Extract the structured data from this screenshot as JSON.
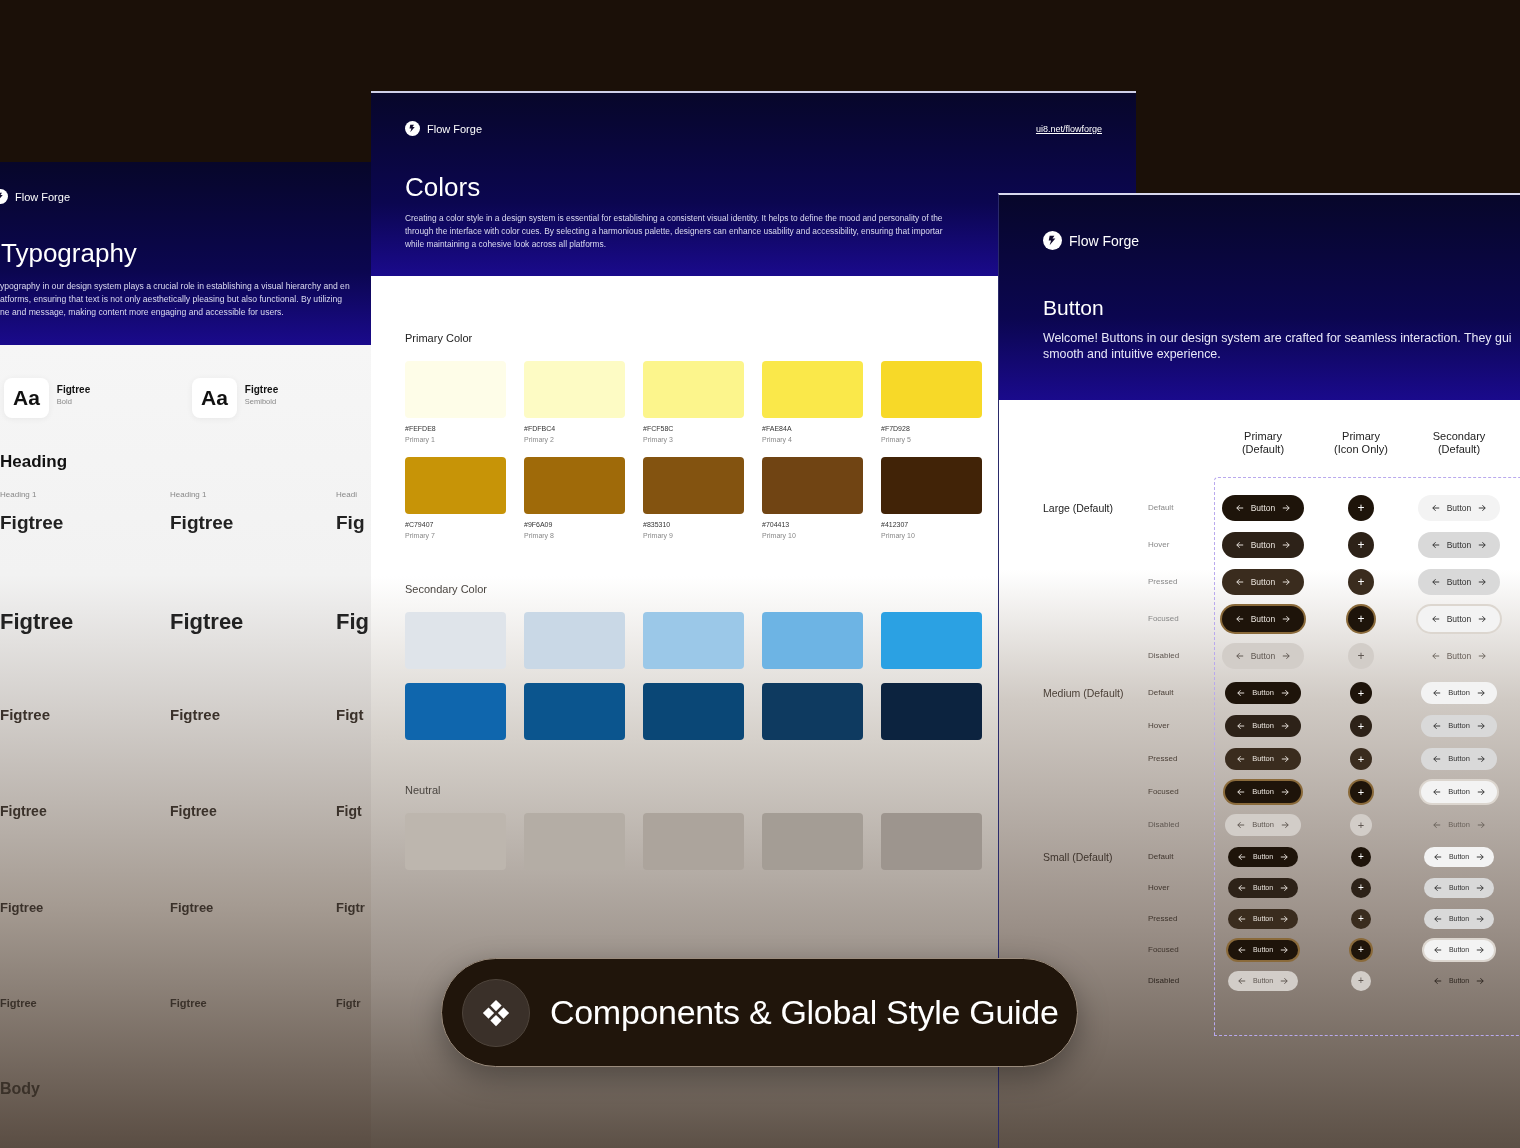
{
  "typography_panel": {
    "brand": "Flow Forge",
    "title": "Typography",
    "description_lines": [
      "ypography in our design system plays a crucial role in establishing a visual hierarchy and en",
      "atforms, ensuring that text is not only aesthetically pleasing but also functional. By utilizing",
      "ne and message, making content more engaging and accessible for users."
    ],
    "fonts": [
      {
        "sample": "Aa",
        "name": "Figtree",
        "weight": "Bold"
      },
      {
        "sample": "Aa",
        "name": "Figtree",
        "weight": "Semibold"
      }
    ],
    "section": "Heading",
    "groups": [
      {
        "items": [
          {
            "label": "Heading 1",
            "sample": "Figtree"
          },
          {
            "label": "Heading 1",
            "sample": "Figtree"
          },
          {
            "label": "Headi",
            "sample": "Fig"
          }
        ]
      },
      {
        "items": [
          {
            "sample": "Figtree"
          },
          {
            "sample": "Figtree"
          },
          {
            "sample": "Fig"
          }
        ]
      },
      {
        "items": [
          {
            "sample": "Figtree"
          },
          {
            "sample": "Figtree"
          },
          {
            "sample": "Figt"
          }
        ]
      },
      {
        "items": [
          {
            "sample": "Figtree"
          },
          {
            "sample": "Figtree"
          },
          {
            "sample": "Figt"
          }
        ]
      },
      {
        "items": [
          {
            "sample": "Figtree"
          },
          {
            "sample": "Figtree"
          },
          {
            "sample": "Figtr"
          }
        ]
      },
      {
        "items": [
          {
            "sample": "Figtree"
          },
          {
            "sample": "Figtree"
          },
          {
            "sample": "Figtr"
          }
        ]
      }
    ],
    "footer_section": "Body"
  },
  "colors_panel": {
    "brand": "Flow Forge",
    "link": "ui8.net/flowforge",
    "title": "Colors",
    "description_lines": [
      "Creating a color style in a design system is essential for establishing a consistent visual identity. It helps to define the mood and personality of the",
      "through the interface with color cues. By selecting a harmonious palette, designers can enhance usability and accessibility, ensuring that importar",
      "while maintaining a cohesive look across all platforms."
    ],
    "sections": [
      {
        "title": "Primary Color",
        "swatches": [
          {
            "color": "#fefde8",
            "hex": "#FEFDE8",
            "name": "Primary 1"
          },
          {
            "color": "#fdfbc4",
            "hex": "#FDFBC4",
            "name": "Primary 2"
          },
          {
            "color": "#fcf58c",
            "hex": "#FCF58C",
            "name": "Primary 3"
          },
          {
            "color": "#fae84a",
            "hex": "#FAE84A",
            "name": "Primary 4"
          },
          {
            "color": "#f7d928",
            "hex": "#F7D928",
            "name": "Primary 5"
          },
          {
            "color": "#c79407",
            "hex": "#C79407",
            "name": "Primary 7"
          },
          {
            "color": "#9f6a09",
            "hex": "#9F6A09",
            "name": "Primary 8"
          },
          {
            "color": "#835310",
            "hex": "#835310",
            "name": "Primary 9"
          },
          {
            "color": "#704413",
            "hex": "#704413",
            "name": "Primary 10"
          },
          {
            "color": "#412307",
            "hex": "#412307",
            "name": "Primary 10"
          }
        ]
      },
      {
        "title": "Secondary Color",
        "swatches": [
          {
            "color": "#dfe4ea"
          },
          {
            "color": "#c9d8e6"
          },
          {
            "color": "#9bc8e8"
          },
          {
            "color": "#6db4e4"
          },
          {
            "color": "#2ba1e3"
          },
          {
            "color": "#0f66ad"
          },
          {
            "color": "#0b558e"
          },
          {
            "color": "#0a4776"
          },
          {
            "color": "#0e3a60"
          },
          {
            "color": "#0c233f"
          }
        ]
      },
      {
        "title": "Neutral",
        "swatches": [
          {
            "color": "#bdb6ae"
          },
          {
            "color": "#b4ada5"
          },
          {
            "color": "#aca49c"
          },
          {
            "color": "#a49d95"
          },
          {
            "color": "#9d958e"
          }
        ]
      }
    ]
  },
  "button_panel": {
    "brand": "Flow Forge",
    "title": "Button",
    "description_lines": [
      "Welcome! Buttons in our design system are crafted for seamless interaction. They gui",
      "smooth and intuitive experience."
    ],
    "columns": [
      "Primary\n(Default)",
      "Primary\n(Icon Only)",
      "Secondary\n(Default)"
    ],
    "groups": [
      {
        "label": "Large (Default)",
        "rows": [
          {
            "state": "Default",
            "kind": "default",
            "primary": "Button",
            "icon": "+",
            "secondary": "Button"
          },
          {
            "state": "Hover",
            "kind": "hover",
            "primary": "Button",
            "icon": "+",
            "secondary": "Button"
          },
          {
            "state": "Pressed",
            "kind": "pressed",
            "primary": "Button",
            "icon": "+",
            "secondary": "Button"
          },
          {
            "state": "Focused",
            "kind": "focused",
            "primary": "Button",
            "icon": "+",
            "secondary": "Button"
          },
          {
            "state": "Disabled",
            "kind": "disabled",
            "primary": "Button",
            "icon": "+",
            "secondary": "Button"
          }
        ]
      },
      {
        "label": "Medium (Default)",
        "rows": [
          {
            "state": "Default",
            "kind": "default",
            "primary": "Button",
            "icon": "+",
            "secondary": "Button"
          },
          {
            "state": "Hover",
            "kind": "hover",
            "primary": "Button",
            "icon": "+",
            "secondary": "Button"
          },
          {
            "state": "Pressed",
            "kind": "pressed",
            "primary": "Button",
            "icon": "+",
            "secondary": "Button"
          },
          {
            "state": "Focused",
            "kind": "focused",
            "primary": "Button",
            "icon": "+",
            "secondary": "Button"
          },
          {
            "state": "Disabled",
            "kind": "disabled",
            "primary": "Button",
            "icon": "+",
            "secondary": "Button"
          }
        ]
      },
      {
        "label": "Small (Default)",
        "rows": [
          {
            "state": "Default",
            "kind": "default",
            "primary": "Button",
            "icon": "+",
            "secondary": "Button"
          },
          {
            "state": "Hover",
            "kind": "hover",
            "primary": "Button",
            "icon": "+",
            "secondary": "Button"
          },
          {
            "state": "Pressed",
            "kind": "pressed",
            "primary": "Button",
            "icon": "+",
            "secondary": "Button"
          },
          {
            "state": "Focused",
            "kind": "focused",
            "primary": "Button",
            "icon": "+",
            "secondary": "Button"
          },
          {
            "state": "Disabled",
            "kind": "disabled",
            "primary": "Button",
            "icon": "+",
            "secondary": "Button"
          }
        ]
      }
    ]
  },
  "badge": {
    "title": "Components & Global Style Guide"
  }
}
